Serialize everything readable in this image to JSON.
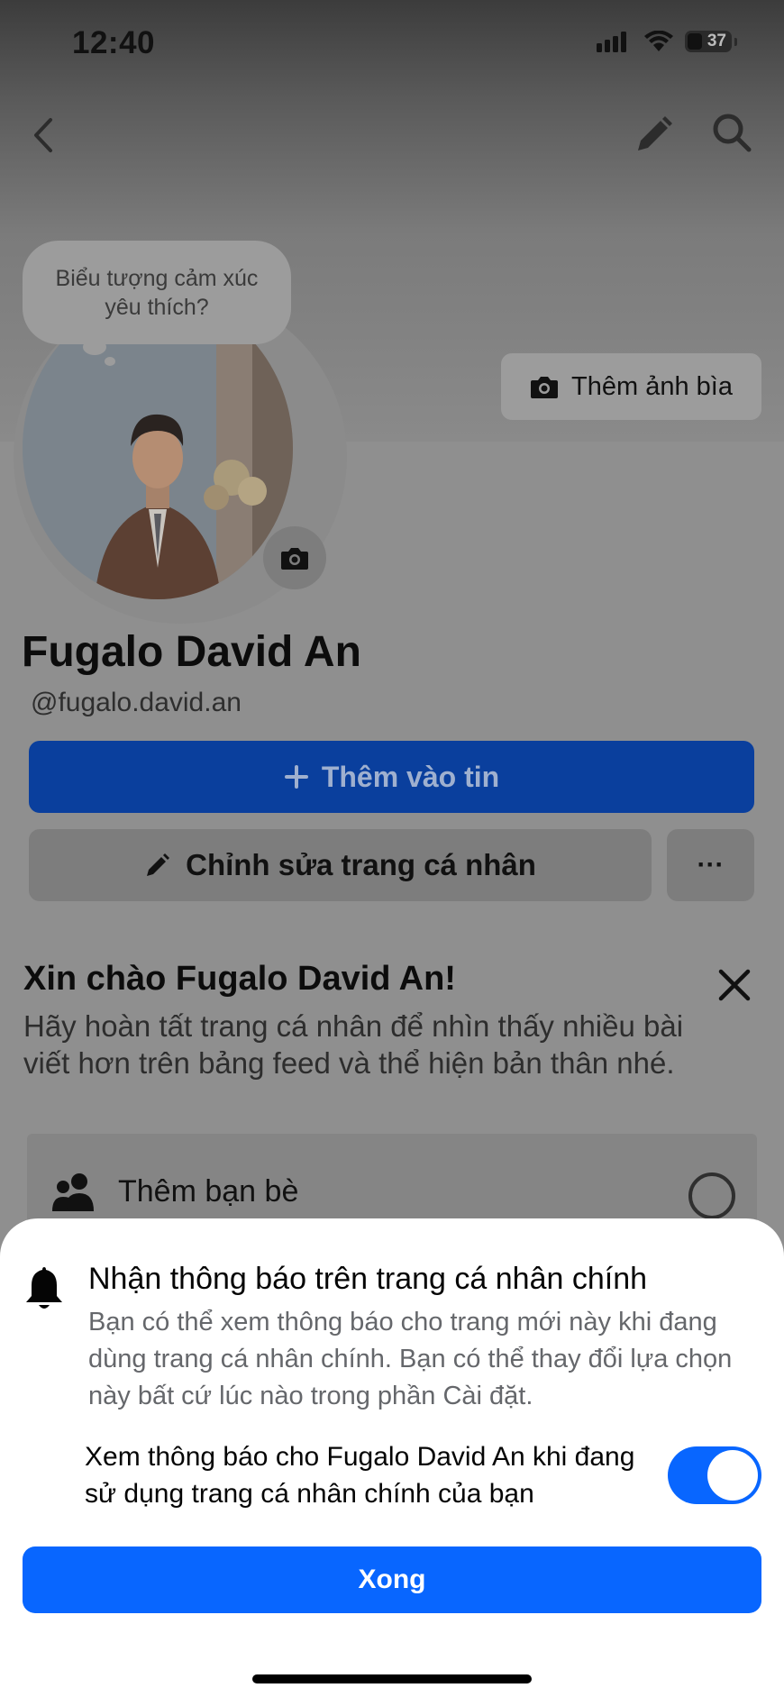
{
  "status_bar": {
    "time": "12:40",
    "battery": "37"
  },
  "header": {
    "back_icon": "chevron-left-icon",
    "edit_icon": "pencil-icon",
    "search_icon": "search-icon"
  },
  "avatar": {
    "bubble_text": "Biểu tượng cảm xúc yêu thích?",
    "camera_icon": "camera-icon"
  },
  "cover": {
    "add_cover_label": "Thêm ảnh bìa"
  },
  "profile": {
    "name": "Fugalo David An",
    "handle": "@fugalo.david.an",
    "add_story_label": "Thêm vào tin",
    "edit_profile_label": "Chỉnh sửa trang cá nhân",
    "more_label": "···"
  },
  "greeting": {
    "title": "Xin chào Fugalo David An!",
    "body": "Hãy hoàn tất trang cá nhân để nhìn thấy nhiều bài viết hơn trên bảng feed và thể hiện bản thân nhé.",
    "task_label": "Thêm bạn bè"
  },
  "sheet": {
    "title": "Nhận thông báo trên trang cá nhân chính",
    "description": "Bạn có thể xem thông báo cho trang mới này khi đang dùng trang cá nhân chính. Bạn có thể thay đổi lựa chọn này bất cứ lúc nào trong phần Cài đặt.",
    "toggle_label": "Xem thông báo cho Fugalo David An khi đang sử dụng trang cá nhân chính của bạn",
    "toggle_on": true,
    "done_label": "Xong"
  },
  "colors": {
    "accent": "#0866ff",
    "text_primary": "#050505",
    "text_secondary": "#65676b"
  }
}
